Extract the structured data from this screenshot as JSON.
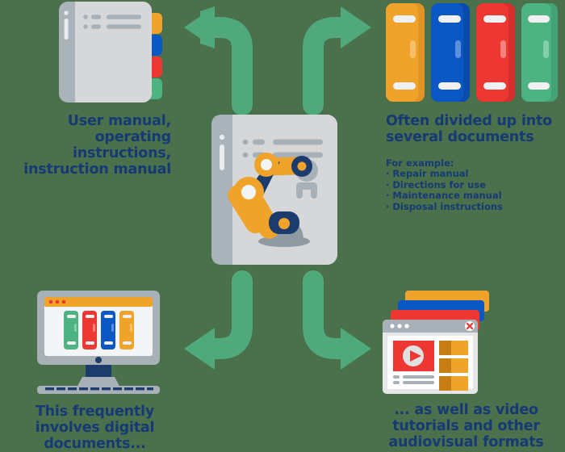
{
  "page": {
    "title": "Types of technical documentation diagram",
    "background_color": "#4a704c"
  },
  "colors": {
    "navy_text": "#173a74",
    "arrow_green": "#4fa97a",
    "orange": "#f0a32a",
    "blue": "#0b57c4",
    "red": "#ec3733",
    "green": "#4db383",
    "gray_light": "#d5d7d8",
    "gray_mid": "#a8b0b8",
    "gray_dark": "#8f9aa3",
    "navy_dark": "#1d3c6e",
    "white": "#ffffff"
  },
  "center": {
    "node_name": "technical-documentation-document",
    "icon": "document-with-robot-arm-icon",
    "text_lines": 2
  },
  "quadrants": {
    "top_left": {
      "icon": "tabbed-manual-icon",
      "tab_colors": [
        "#f0a32a",
        "#0b57c4",
        "#ec3733",
        "#4db383"
      ],
      "caption": "User manual,\noperating instructions,\ninstruction manual",
      "arrow": "arrow-up-left"
    },
    "top_right": {
      "icon": "book-spines-icon",
      "book_colors": [
        "#f0a32a",
        "#0b57c4",
        "#ec3733",
        "#4db383"
      ],
      "caption": "Often divided up into\nseveral documents",
      "examples_heading": "For example:",
      "examples": [
        "· Repair manual",
        "· Directions for use",
        "· Maintenance manual",
        "· Disposal instructions"
      ],
      "arrow": "arrow-up-right"
    },
    "bottom_left": {
      "icon": "desktop-computer-icon",
      "screen_book_colors": [
        "#4db383",
        "#ec3733",
        "#0b57c4",
        "#f0a32a"
      ],
      "caption": "This frequently\ninvolves digital\ndocuments...",
      "arrow": "arrow-down-left"
    },
    "bottom_right": {
      "icon": "video-browser-windows-icon",
      "stacked_window_colors": [
        "#f0a32a",
        "#0b57c4",
        "#ec3733"
      ],
      "player_color": "#ec3733",
      "thumbnail_color": "#f0a32a",
      "caption": "... as well as video\ntutorials and other\naudiovisual formats",
      "arrow": "arrow-down-right"
    }
  },
  "arrows": {
    "count": 4,
    "color": "#4fa97a",
    "names": [
      "arrow-up-left",
      "arrow-up-right",
      "arrow-down-left",
      "arrow-down-right"
    ]
  }
}
